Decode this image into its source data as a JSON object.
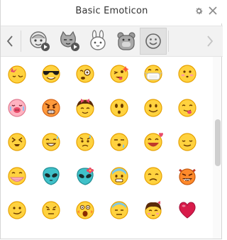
{
  "window": {
    "title": "Basic Emoticon"
  },
  "icons": {
    "settings": "gear-icon",
    "close": "close-icon",
    "prev": "chevron-left-icon",
    "next": "chevron-right-icon"
  },
  "tabs": [
    {
      "name": "animated-face-pack",
      "active": false
    },
    {
      "name": "animated-cat-pack",
      "active": false
    },
    {
      "name": "rabbit-pack",
      "active": false
    },
    {
      "name": "bear-pack",
      "active": false
    },
    {
      "name": "basic-emoticon",
      "active": true
    }
  ],
  "emoticons": [
    [
      "moon-night",
      "cool-sunglasses",
      "dizzy",
      "wink-tongue",
      "sick-mask",
      "blush"
    ],
    [
      "crying-pig",
      "angry-pouting",
      "girl-bow",
      "surprised",
      "smile",
      "tongue-out"
    ],
    [
      "squint-laugh",
      "smile-sweat",
      "worried",
      "sleepy-drool",
      "laugh-hearts",
      "content"
    ],
    [
      "embarrassed",
      "alien",
      "alien-flower",
      "cold-sweat",
      "sad",
      "devil"
    ],
    [
      "smirk",
      "annoyed",
      "scared",
      "sweat-flat",
      "shy-girl",
      "heart"
    ]
  ],
  "colors": {
    "face": "#FFD23F",
    "face_edge": "#E6A100",
    "accent": "#E94B6A",
    "alien": "#3FC1C9",
    "devil": "#FF8A2B"
  }
}
